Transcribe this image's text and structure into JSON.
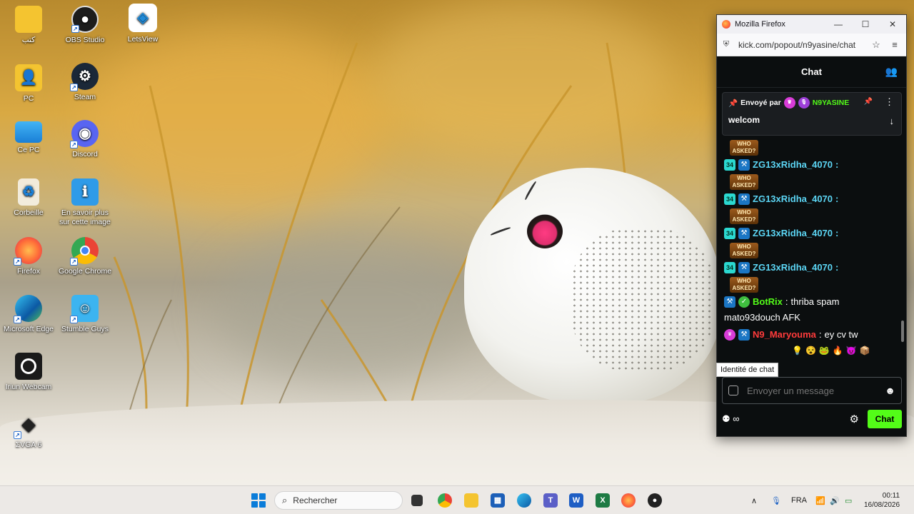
{
  "desktop": {
    "icons": [
      {
        "label": "كتب",
        "icon": "folder-icon"
      },
      {
        "label": "OBS Studio",
        "icon": "obs-icon"
      },
      {
        "label": "LetsView",
        "icon": "letsview-icon"
      },
      {
        "label": "PC",
        "icon": "folder-icon"
      },
      {
        "label": "Steam",
        "icon": "steam-icon"
      },
      {
        "label": "Ce PC",
        "icon": "monitor-icon"
      },
      {
        "label": "Discord",
        "icon": "discord-icon"
      },
      {
        "label": "Corbeille",
        "icon": "recycle-bin-icon"
      },
      {
        "label": "En savoir plus sur cette image",
        "icon": "info-picture-icon"
      },
      {
        "label": "Firefox",
        "icon": "firefox-icon"
      },
      {
        "label": "Google Chrome",
        "icon": "chrome-icon"
      },
      {
        "label": "Microsoft Edge",
        "icon": "edge-icon"
      },
      {
        "label": "Stumble Guys",
        "icon": "stumble-guys-icon"
      },
      {
        "label": "Iriun Webcam",
        "icon": "webcam-icon"
      },
      {
        "label": "ΣVGA 6",
        "icon": "vga-icon"
      }
    ]
  },
  "browser": {
    "window_title": "Mozilla Firefox",
    "url": "kick.com/popout/n9yasine/chat",
    "controls": {
      "minimize": "—",
      "maximize": "☐",
      "close": "✕"
    }
  },
  "chat": {
    "header_title": "Chat",
    "pinned": {
      "prefix": "Envoyé par",
      "sender": "N9YASINE",
      "message": "welcom"
    },
    "emote_label": "WHO ASKED?",
    "messages": [
      {
        "badge_level": "34",
        "user": "ZG13xRidha_4070",
        "user_color": "#5cd6f5",
        "text": ""
      },
      {
        "badge_level": "34",
        "user": "ZG13xRidha_4070",
        "user_color": "#5cd6f5",
        "text": ""
      },
      {
        "badge_level": "34",
        "user": "ZG13xRidha_4070",
        "user_color": "#5cd6f5",
        "text": ""
      },
      {
        "badge_level": "34",
        "user": "ZG13xRidha_4070",
        "user_color": "#5cd6f5",
        "text": ""
      }
    ],
    "botrix": {
      "user": "BotRix",
      "user_color": "#53fc18",
      "text": "thriba spam",
      "text2": "mato93douch AFK"
    },
    "maryouma": {
      "user": "N9_Maryouma",
      "user_color": "#ff3b3b",
      "text": "ey cv tw"
    },
    "tooltip": "Identité de chat",
    "input_placeholder": "Envoyer un message",
    "send_label": "Chat"
  },
  "taskbar": {
    "search_placeholder": "Rechercher",
    "language": "FRA",
    "time": "00:11",
    "date": "16/08/2026"
  }
}
